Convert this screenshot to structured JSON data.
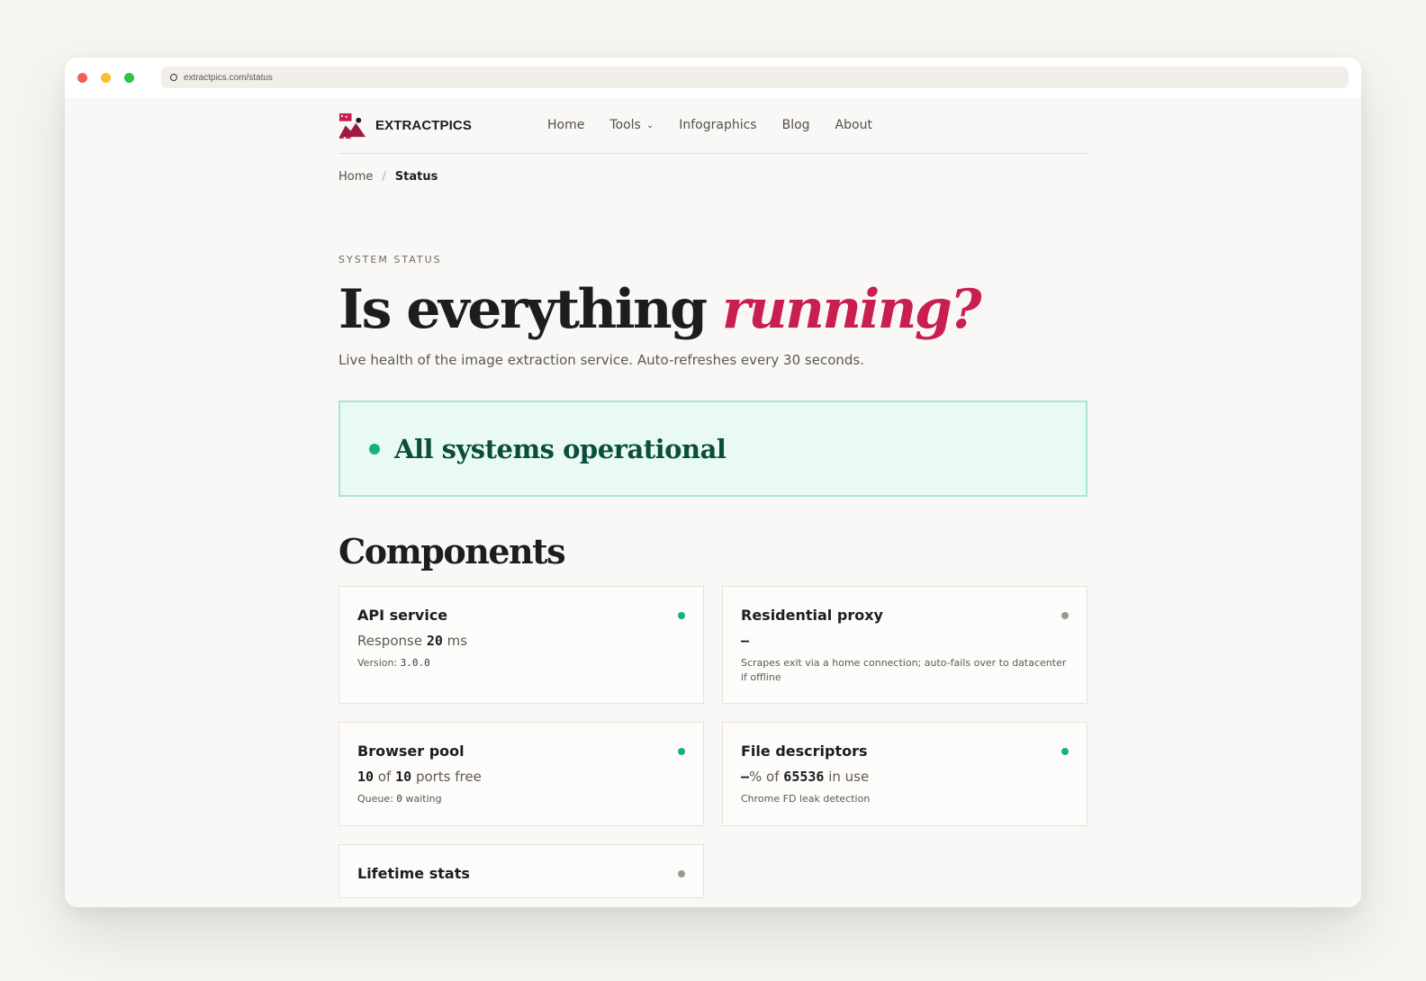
{
  "browser": {
    "url": "extractpics.com/status"
  },
  "brand": {
    "name": "EXTRACTPICS",
    "accent_color": "#c81f4f"
  },
  "nav": {
    "home": "Home",
    "tools": "Tools",
    "infographics": "Infographics",
    "blog": "Blog",
    "about": "About"
  },
  "breadcrumb": {
    "home": "Home",
    "separator": "/",
    "current": "Status"
  },
  "hero": {
    "eyebrow": "SYSTEM STATUS",
    "title_main": "Is everything",
    "title_accent": "running?",
    "subtitle": "Live health of the image extraction service. Auto-refreshes every 30 seconds."
  },
  "overall": {
    "text": "All systems operational",
    "status_color": "#17b17a"
  },
  "components": {
    "title": "Components",
    "api": {
      "name": "API service",
      "status": "ok",
      "metric_prefix": "Response",
      "metric_value": "20",
      "metric_suffix": "ms",
      "note_label": "Version:",
      "note_value": "3.0.0"
    },
    "proxy": {
      "name": "Residential proxy",
      "status": "unknown",
      "metric_value": "–",
      "note": "Scrapes exit via a home connection; auto-fails over to datacenter if offline"
    },
    "browser_pool": {
      "name": "Browser pool",
      "status": "ok",
      "metric_free": "10",
      "metric_of": "of",
      "metric_total": "10",
      "metric_suffix": "ports free",
      "note_label": "Queue:",
      "note_value": "0",
      "note_suffix": "waiting"
    },
    "fd": {
      "name": "File descriptors",
      "status": "ok",
      "metric_percent": "–",
      "metric_percent_suffix": "% of",
      "metric_total": "65536",
      "metric_suffix": "in use",
      "note": "Chrome FD leak detection"
    },
    "lifetime": {
      "name": "Lifetime stats",
      "status": "unknown"
    }
  }
}
